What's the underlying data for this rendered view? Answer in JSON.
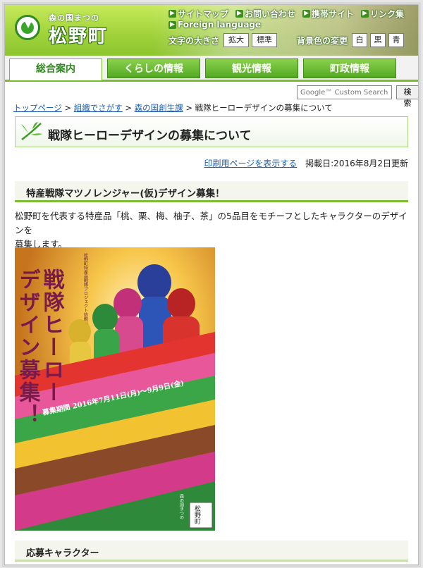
{
  "header": {
    "logo_sub": "森の国まつの",
    "logo_name": "松野町",
    "util_links": [
      "サイトマップ",
      "お問い合わせ",
      "携帯サイト",
      "リンク集"
    ],
    "foreign_language": "Foreign language",
    "fontsize_label": "文字の大きさ",
    "fontsize_options": [
      "拡大",
      "標準"
    ],
    "bgcolor_label": "背景色の変更",
    "bgcolor_options": [
      "白",
      "黒",
      "青"
    ]
  },
  "nav": {
    "tabs": [
      "総合案内",
      "くらしの情報",
      "観光情報",
      "町政情報"
    ],
    "active": "総合案内"
  },
  "search": {
    "placeholder": "Google™ Custom Search",
    "button": "検索"
  },
  "breadcrumb": {
    "items": [
      "トップページ",
      "組織でさがす",
      "森の国創生課"
    ],
    "separator": ">",
    "current": "戦隊ヒーローデザインの募集について"
  },
  "page": {
    "title": "戦隊ヒーローデザインの募集について",
    "print_link": "印刷用ページを表示する",
    "date_label": "掲載日:2016年8月2日更新",
    "subheading": "特産戦隊マツノレンジャー(仮)デザイン募集！",
    "body_line1": "松野町を代表する特産品「桃、栗、梅、柚子、茶」の5品目をモチーフとしたキャラクターのデザインを",
    "body_line2": "募集します。",
    "subheading2": "応募キャラクター"
  },
  "poster": {
    "vertical_title_1": "戦隊ヒーロー",
    "vertical_title_2": "デザイン募集！",
    "project_label": "松野町特産品戦隊プロジェクト始動！",
    "period": "募集期間 2016年7月11日(月)〜9月9日(金)",
    "footer_label": "森の国まつの",
    "seal": "松野町"
  },
  "colors": {
    "header_green": "#9fd23a",
    "nav_green": "#52a923",
    "link_blue": "#1a5fb4",
    "accent_line": "#7cbf35"
  }
}
